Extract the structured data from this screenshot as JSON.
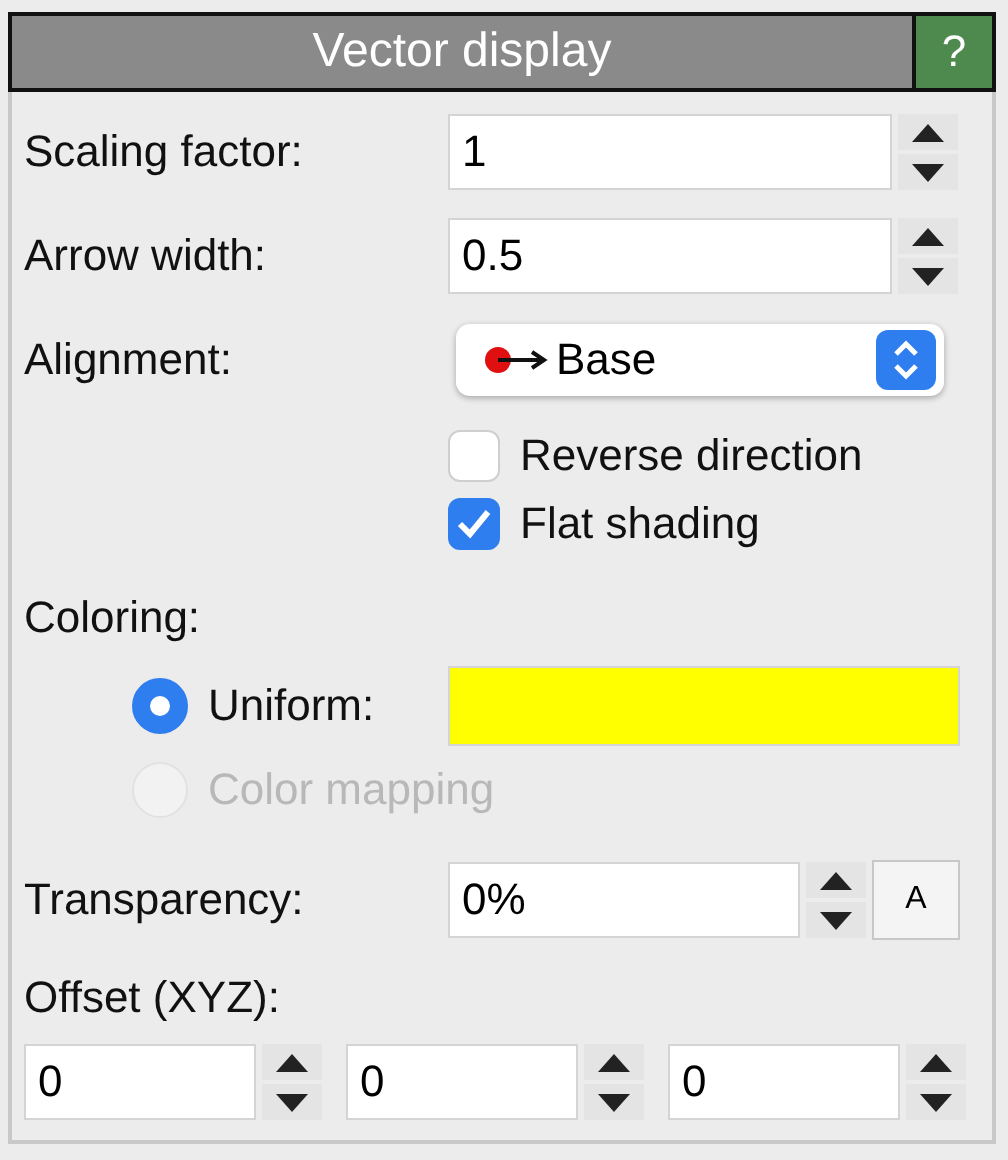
{
  "panel": {
    "title": "Vector display",
    "help": "?"
  },
  "fields": [
    {
      "label": "Scaling factor:",
      "value": "1"
    },
    {
      "label": "Arrow width:",
      "value": "0.5"
    }
  ],
  "alignment": {
    "label": "Alignment:",
    "value": "Base"
  },
  "checkboxes": [
    {
      "label": "Reverse direction",
      "checked": false
    },
    {
      "label": "Flat shading",
      "checked": true
    }
  ],
  "coloring": {
    "label": "Coloring:",
    "options": [
      {
        "label": "Uniform:",
        "selected": true,
        "disabled": false,
        "color": "#ffff00"
      },
      {
        "label": "Color mapping",
        "selected": false,
        "disabled": true
      }
    ]
  },
  "transparency": {
    "label": "Transparency:",
    "value": "0%",
    "button": "A"
  },
  "offset": {
    "label": "Offset (XYZ):",
    "values": [
      "0",
      "0",
      "0"
    ]
  }
}
